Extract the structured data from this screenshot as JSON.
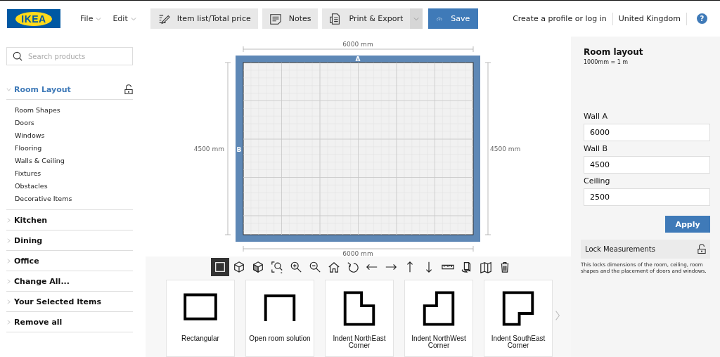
{
  "header": {
    "logo": "IKEA",
    "menus": [
      {
        "label": "File"
      },
      {
        "label": "Edit"
      }
    ],
    "buttons": [
      {
        "label": "Item list/Total price",
        "kind": "list"
      },
      {
        "label": "Notes",
        "kind": "notes"
      },
      {
        "label": "Print & Export",
        "kind": "print"
      }
    ],
    "save": "Save",
    "links": [
      "Create a profile or log in",
      "United Kingdom"
    ],
    "help": "?"
  },
  "sidebar": {
    "search": {
      "placeholder": "Search products"
    },
    "sections": [
      {
        "label": "Room Layout",
        "expanded": true,
        "children": [
          "Room Shapes",
          "Doors",
          "Windows",
          "Flooring",
          "Walls & Ceiling",
          "Fixtures",
          "Obstacles",
          "Decorative Items"
        ]
      },
      {
        "label": "Kitchen",
        "expanded": false
      },
      {
        "label": "Dining",
        "expanded": false
      },
      {
        "label": "Office",
        "expanded": false
      },
      {
        "label": "Change All...",
        "expanded": false
      },
      {
        "label": "Your Selected Items",
        "expanded": false
      },
      {
        "label": "Remove all",
        "expanded": false
      }
    ]
  },
  "plan": {
    "top": "6000 mm",
    "bottom": "6000 mm",
    "left": "4500 mm",
    "right": "4500 mm",
    "wall_a": "A",
    "wall_b": "B"
  },
  "tools": [
    {
      "selected": true
    },
    {
      "selected": false
    },
    {
      "selected": false
    },
    {
      "selected": false
    },
    {
      "selected": false
    },
    {
      "selected": false
    },
    {
      "selected": false
    },
    {
      "selected": false
    },
    {
      "selected": false
    },
    {
      "selected": false
    },
    {
      "selected": false
    },
    {
      "selected": false
    },
    {
      "selected": false
    },
    {
      "selected": false
    },
    {
      "selected": false
    },
    {
      "selected": false
    }
  ],
  "shapes": [
    {
      "label": "Rectangular"
    },
    {
      "label": "Open room solution"
    },
    {
      "label": "Indent NorthEast Corner"
    },
    {
      "label": "Indent NorthWest Corner"
    },
    {
      "label": "Indent SouthEast Corner"
    }
  ],
  "panel": {
    "title": "Room layout",
    "scale": "1000mm = 1 m",
    "fields": [
      {
        "label": "Wall A",
        "value": "6000"
      },
      {
        "label": "Wall B",
        "value": "4500"
      },
      {
        "label": "Ceiling",
        "value": "2500"
      }
    ],
    "apply": "Apply",
    "lock": {
      "label": "Lock Measurements"
    },
    "note": "This locks dimensions of the room, ceiling, room shapes and the placement of doors and windows."
  }
}
